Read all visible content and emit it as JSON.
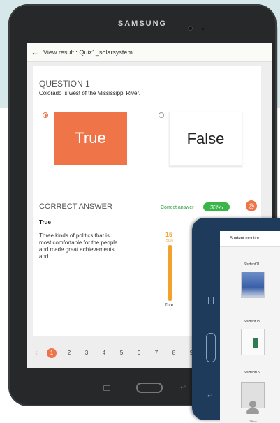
{
  "device": {
    "brand": "SAMSUNG"
  },
  "app": {
    "title": "View result : Quiz1_solarsystem"
  },
  "question": {
    "number_label": "QUESTION 1",
    "text": "Colorado is west of the Mississippi River.",
    "options": [
      {
        "label": "True",
        "selected": true
      },
      {
        "label": "False",
        "selected": false
      }
    ]
  },
  "correct_answer": {
    "title": "CORRECT ANSWER",
    "rate_label": "Correct answer",
    "rate_value": "33%",
    "answer": "True",
    "explanation": "Three kinds of politics that is most comfortable for the people and made great achievements and"
  },
  "response_bar": {
    "count": "15",
    "percent": "50%",
    "label": "Ture",
    "fraction": 0.5
  },
  "pager": {
    "pages": [
      "1",
      "2",
      "3",
      "4",
      "5",
      "6",
      "7",
      "8",
      "9"
    ],
    "current": "1"
  },
  "monitor": {
    "title": "Student monitor",
    "students": [
      "Student01",
      "Student08",
      "Student15"
    ],
    "offline_label": "Offline"
  },
  "colors": {
    "accent": "#ef7448",
    "success": "#3ab54a",
    "bar": "#f2a22c",
    "second_tablet": "#1e3b5c"
  },
  "icons": {
    "back": "arrow-left-icon",
    "target": "target-icon",
    "home": "home-button-icon",
    "recent": "recent-apps-icon"
  }
}
